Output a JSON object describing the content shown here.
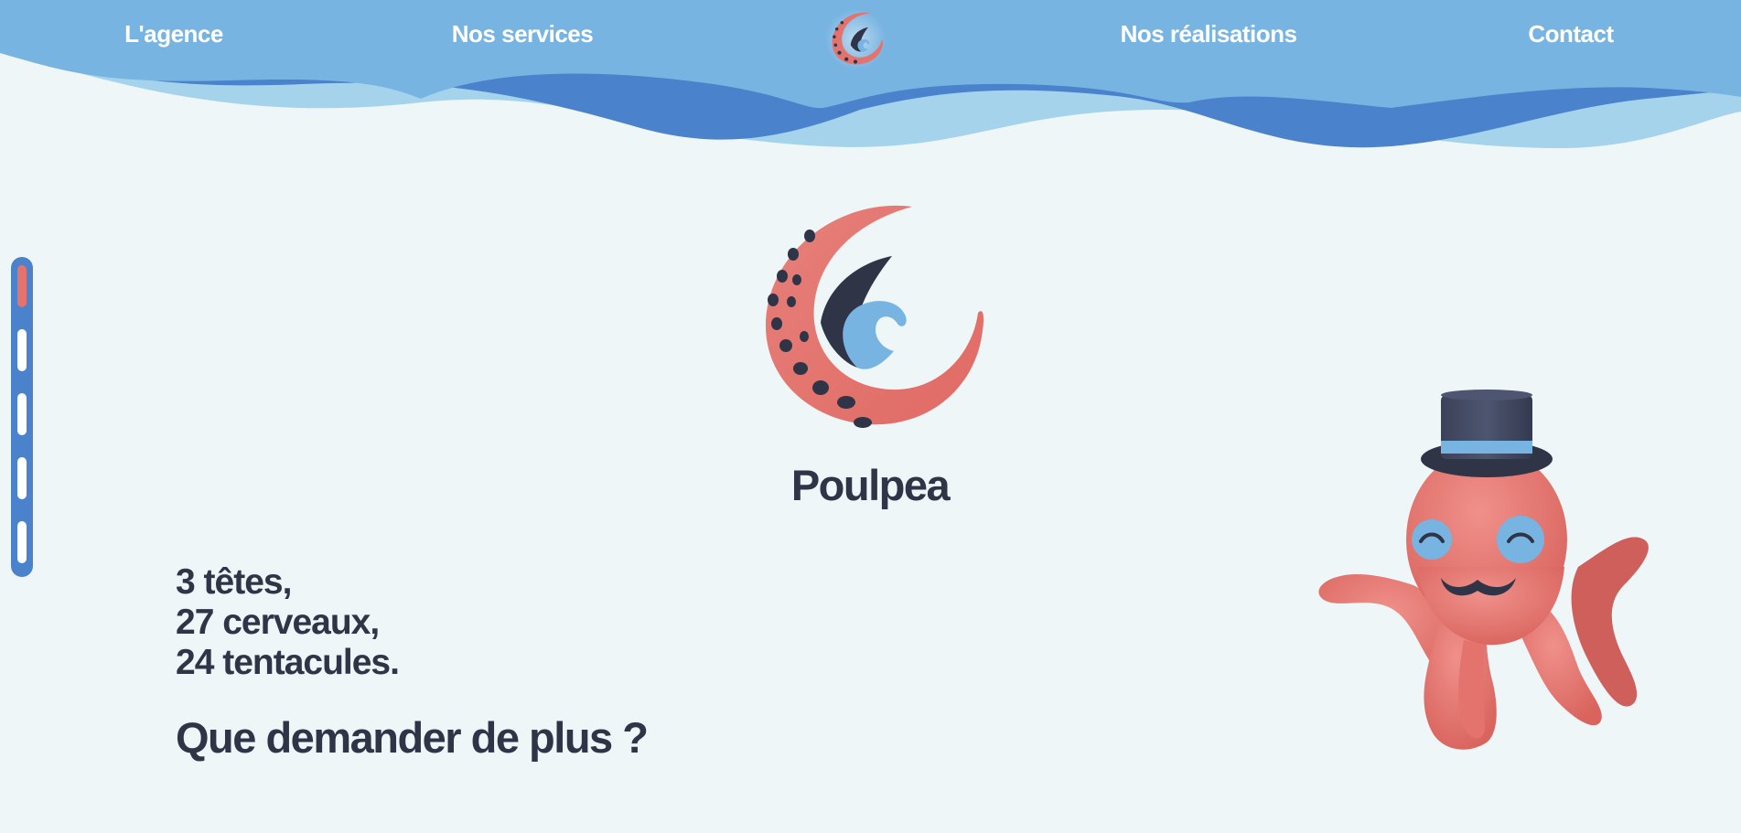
{
  "nav": {
    "items": [
      {
        "label": "L'agence"
      },
      {
        "label": "Nos services"
      },
      {
        "label": "Nos réalisations"
      },
      {
        "label": "Contact"
      }
    ],
    "logo_icon": "poulpea-logo-icon"
  },
  "slide_nav": {
    "count": 5,
    "active_index": 0
  },
  "hero": {
    "brand_name": "Poulpea",
    "tagline_lines": [
      "3 têtes,",
      "27 cerveaux,",
      "24 tentacules."
    ],
    "question": "Que demander de plus ?"
  },
  "colors": {
    "background": "#eef6f7",
    "header_blue": "#78b4e1",
    "wave_dark": "#4a82cc",
    "wave_light": "#a5d3ec",
    "coral": "#e4736d",
    "navy": "#2f3447",
    "text_white": "#ffffff"
  },
  "icons": {
    "logo": "octopus-tentacle-wave-icon",
    "mascot": "octopus-top-hat-mascot"
  }
}
